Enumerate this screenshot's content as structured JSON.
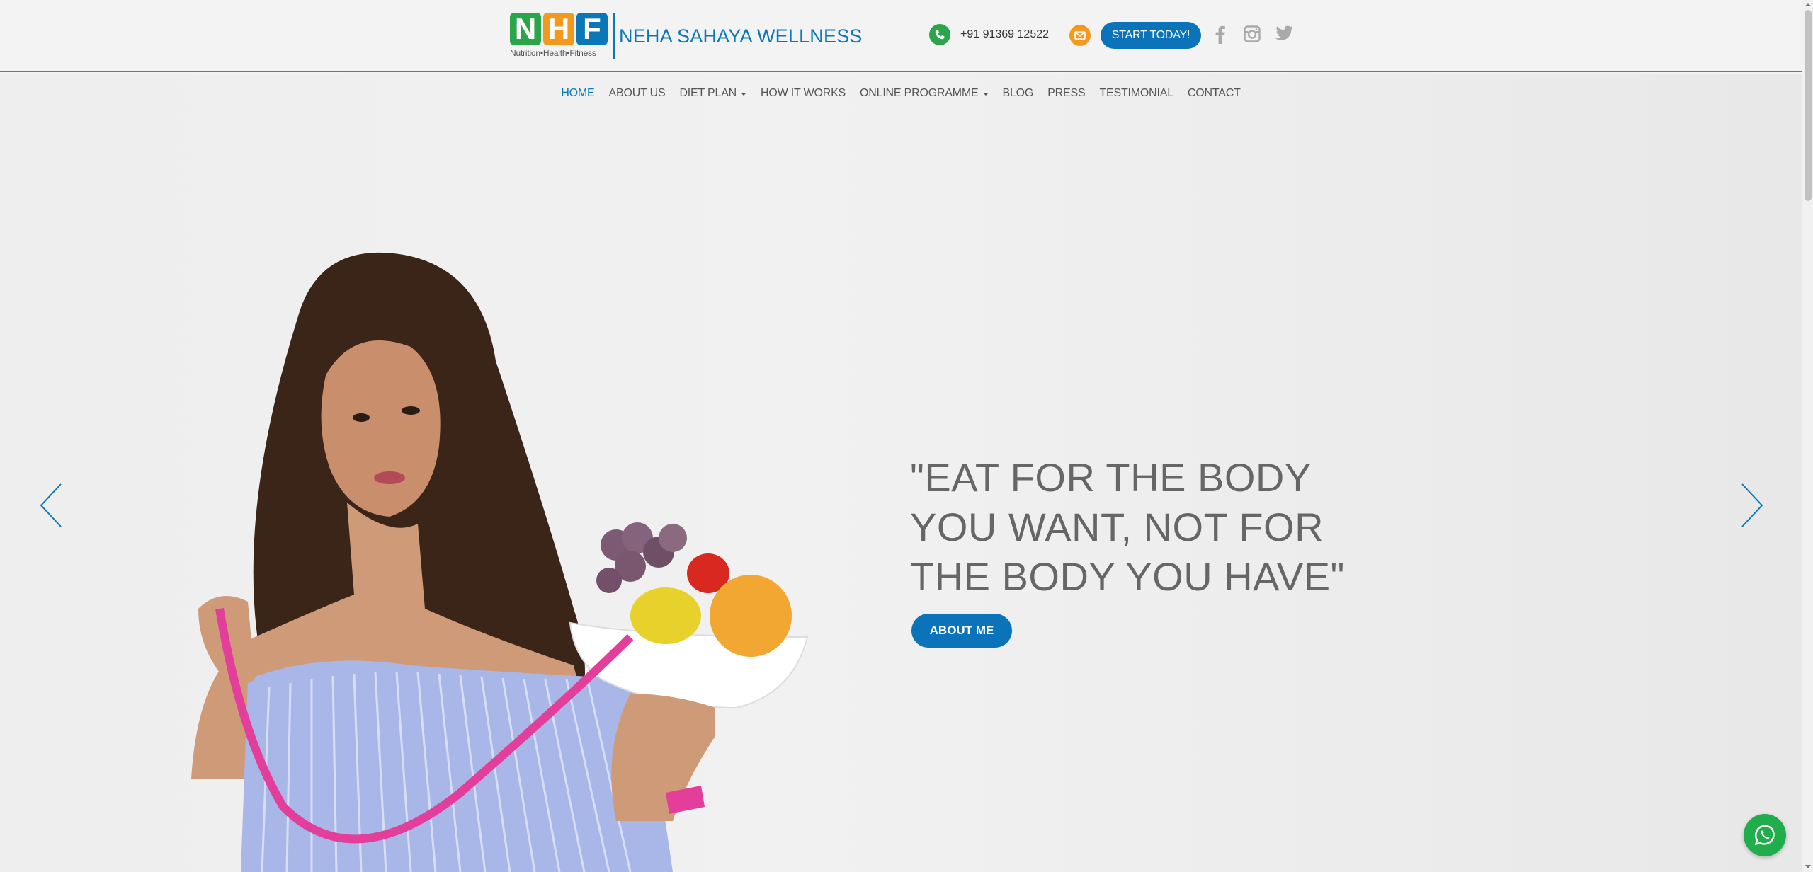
{
  "brand": {
    "letters": [
      "N",
      "H",
      "F"
    ],
    "letter_colors": [
      "#2aa54a",
      "#f39a1e",
      "#0a78b6"
    ],
    "tagline": "Nutrition•Health•Fitness",
    "name": "NEHA SAHAYA WELLNESS"
  },
  "header": {
    "phone": "+91 91369 12522",
    "cta_label": "START TODAY!",
    "social": [
      "facebook-icon",
      "instagram-icon",
      "twitter-icon"
    ],
    "accent_color": "#0b73b9",
    "phone_icon_color": "#2aa54a",
    "mail_icon_color": "#f39a1e"
  },
  "nav": {
    "items": [
      {
        "label": "HOME",
        "active": true
      },
      {
        "label": "ABOUT US"
      },
      {
        "label": "DIET PLAN",
        "dropdown": true
      },
      {
        "label": "HOW IT WORKS"
      },
      {
        "label": "ONLINE PROGRAMME",
        "dropdown": true
      },
      {
        "label": "BLOG"
      },
      {
        "label": "PRESS"
      },
      {
        "label": "TESTIMONIAL"
      },
      {
        "label": "CONTACT"
      }
    ]
  },
  "hero": {
    "quote_lines": [
      "\"EAT FOR THE BODY",
      "YOU WANT, NOT FOR",
      "THE BODY YOU HAVE\""
    ],
    "button_label": "ABOUT ME",
    "prev_icon": "chevron-left-icon",
    "next_icon": "chevron-right-icon"
  },
  "floating": {
    "whatsapp_icon": "whatsapp-icon",
    "whatsapp_color": "#1fae4b"
  }
}
